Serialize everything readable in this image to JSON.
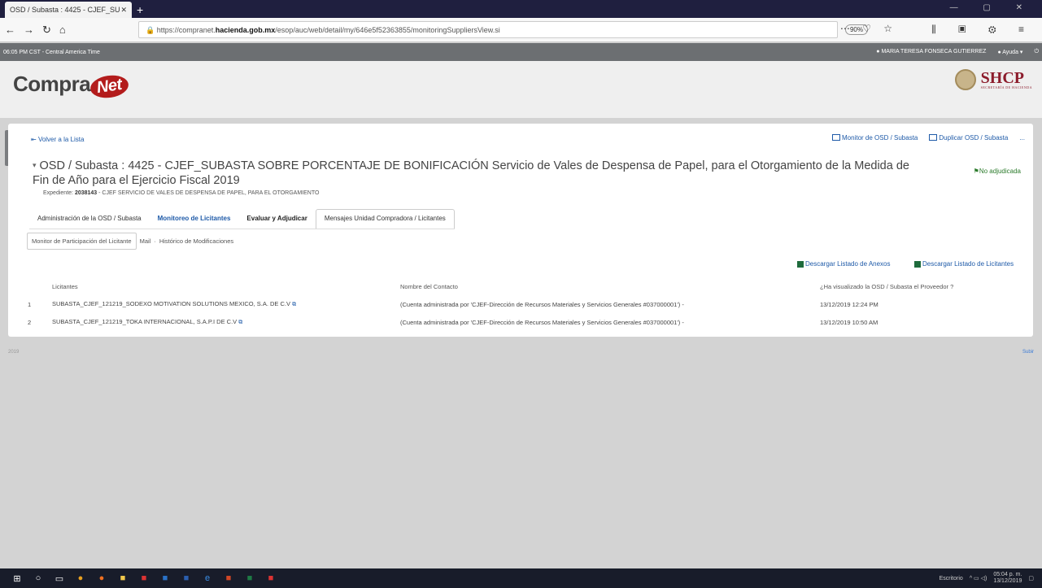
{
  "browser": {
    "tab_title": "OSD / Subasta : 4425 - CJEF_SU",
    "url_pre": "https://compranet.",
    "url_host": "hacienda.gob.mx",
    "url_post": "/esop/auc/web/detail/my/646e5f52363855/monitoringSuppliersView.si",
    "zoom": "90%"
  },
  "appbar": {
    "time": "06:05 PM CST - Central America Time",
    "user": "MARIA TERESA FONSECA GUTIERREZ",
    "help": "Ayuda"
  },
  "header": {
    "logo_a": "Compra",
    "logo_b": "Net",
    "shcp": "SHCP",
    "shcp_sub": "SECRETARÍA DE HACIENDA"
  },
  "nav": {
    "back": "Volver a la Lista",
    "actions": [
      "Monitor de OSD / Subasta",
      "Duplicar OSD / Subasta",
      "..."
    ]
  },
  "title": "OSD / Subasta : 4425 - CJEF_SUBASTA SOBRE PORCENTAJE DE BONIFICACIÓN Servicio de Vales de Despensa de Papel, para el Otorgamiento de la Medida de Fin de Año para el Ejercicio Fiscal 2019",
  "status": "No adjudicada",
  "expediente": {
    "label": "Expediente:",
    "value": "2038143",
    "desc": "- CJEF SERVICIO DE VALES DE DESPENSA DE PAPEL, PARA EL OTORGAMIENTO"
  },
  "tabs": [
    "Administración de la OSD / Subasta",
    "Monitoreo de Licitantes",
    "Evaluar y Adjudicar",
    "Mensajes Unidad Compradora / Licitantes"
  ],
  "subtabs": [
    "Monitor de Participación del Licitante",
    "Mail",
    "Histórico de Modificaciones"
  ],
  "downloads": [
    "Descargar Listado de Anexos",
    "Descargar Listado de Licitantes"
  ],
  "table": {
    "headers": [
      "",
      "Licitantes",
      "Nombre del Contacto",
      "¿Ha visualizado la OSD / Subasta el Proveedor ?"
    ],
    "rows": [
      {
        "n": "1",
        "lic": "SUBASTA_CJEF_121219_SODEXO MOTIVATION SOLUTIONS MEXICO, S.A. DE C.V",
        "contact": "(Cuenta administrada por 'CJEF-Dirección de Recursos Materiales y Servicios Generales #037000001') -",
        "seen": "13/12/2019 12:24 PM"
      },
      {
        "n": "2",
        "lic": "SUBASTA_CJEF_121219_TOKA INTERNACIONAL, S.A.P.I DE C.V",
        "contact": "(Cuenta administrada por 'CJEF-Dirección de Recursos Materiales y Servicios Generales #037000001') -",
        "seen": "13/12/2019 10:50 AM"
      }
    ]
  },
  "footer": {
    "left": "2019",
    "right": "Subir"
  },
  "taskbar": {
    "lang": "Escritorio",
    "time": "05:04 p. m.",
    "date": "13/12/2019"
  }
}
